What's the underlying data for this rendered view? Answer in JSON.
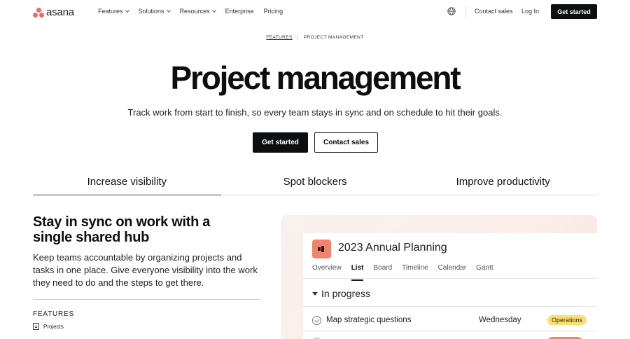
{
  "nav": {
    "logo_text": "asana",
    "links": [
      {
        "label": "Features",
        "dropdown": true
      },
      {
        "label": "Solutions",
        "dropdown": true
      },
      {
        "label": "Resources",
        "dropdown": true
      },
      {
        "label": "Enterprise",
        "dropdown": false
      },
      {
        "label": "Pricing",
        "dropdown": false
      }
    ],
    "globe_icon": "globe-icon",
    "contact_sales": "Contact sales",
    "log_in": "Log In",
    "get_started": "Get started"
  },
  "breadcrumb": {
    "parent": "FEATURES",
    "current": "PROJECT MANAGEMENT"
  },
  "hero": {
    "title": "Project management",
    "subtitle": "Track work from start to finish, so every team stays in sync and on schedule to hit their goals.",
    "primary_button": "Get started",
    "secondary_button": "Contact sales"
  },
  "tabs": [
    {
      "label": "Increase visibility",
      "active": true
    },
    {
      "label": "Spot blockers",
      "active": false
    },
    {
      "label": "Improve productivity",
      "active": false
    }
  ],
  "feature_section": {
    "title": "Stay in sync on work with a single shared hub",
    "body": "Keep teams accountable by organizing projects and tasks in one place. Give everyone visibility into the work they need to do and the steps to get there.",
    "features_label": "FEATURES",
    "features": [
      {
        "label": "Projects",
        "icon": "projects-icon"
      }
    ]
  },
  "project_card": {
    "title": "2023 Annual Planning",
    "icon": "megaphone-icon",
    "views": [
      {
        "label": "Overview",
        "active": false
      },
      {
        "label": "List",
        "active": true
      },
      {
        "label": "Board",
        "active": false
      },
      {
        "label": "Timeline",
        "active": false
      },
      {
        "label": "Calendar",
        "active": false
      },
      {
        "label": "Gantt",
        "active": false
      }
    ],
    "section": "In progress",
    "tasks": [
      {
        "name": "Map strategic questions",
        "due": "Wednesday",
        "tag": "Operations",
        "tag_color": "#f8df72"
      }
    ]
  },
  "colors": {
    "accent": "#f06a6a",
    "dark_button": "#0d0e10",
    "project_icon": "#f1826c"
  }
}
